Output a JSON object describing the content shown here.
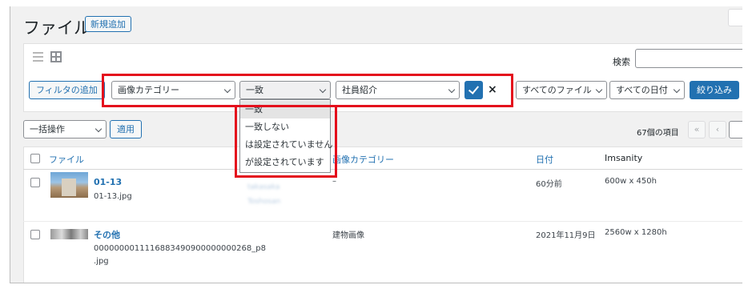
{
  "header": {
    "title": "ファイル",
    "add_new_label": "新規追加"
  },
  "search": {
    "label": "検索",
    "value": ""
  },
  "filter_bar": {
    "add_filter_label": "フィルタの追加",
    "category_select": "画像カテゴリー",
    "match_select": "一致",
    "value_select": "社員紹介",
    "apply_icon": "check-icon",
    "cancel_symbol": "×",
    "files_select": "すべてのファイル",
    "dates_select": "すべての日付",
    "narrow_button": "絞り込み"
  },
  "match_dropdown": {
    "options": [
      "一致",
      "一致しない",
      "は設定されていません",
      "が設定されています"
    ],
    "selected_index": 0
  },
  "bulk": {
    "select_label": "一括操作",
    "apply_label": "適用"
  },
  "pagination": {
    "count_label": "67個の項目",
    "first_symbol": "«",
    "prev_symbol": "‹"
  },
  "table": {
    "columns": [
      "ファイル",
      "画像カテゴリー",
      "日付",
      "Imsanity"
    ],
    "rows": [
      {
        "title": "01-13",
        "filename": "01-13.jpg",
        "author_blurred_1": "takasaka",
        "author_blurred_2": "Toshosan",
        "category": "–",
        "date": "60分前",
        "size": "600w x 450h"
      },
      {
        "title": "その他",
        "filename_line1": "0000000011116883490900000000268_p8",
        "filename_line2": ".jpg",
        "category": "建物画像",
        "date": "2021年11月9日",
        "size": "2560w x 1280h"
      }
    ]
  },
  "colors": {
    "accent": "#2271b1",
    "highlight": "#e40f1c",
    "background": "#f1f1f1"
  }
}
